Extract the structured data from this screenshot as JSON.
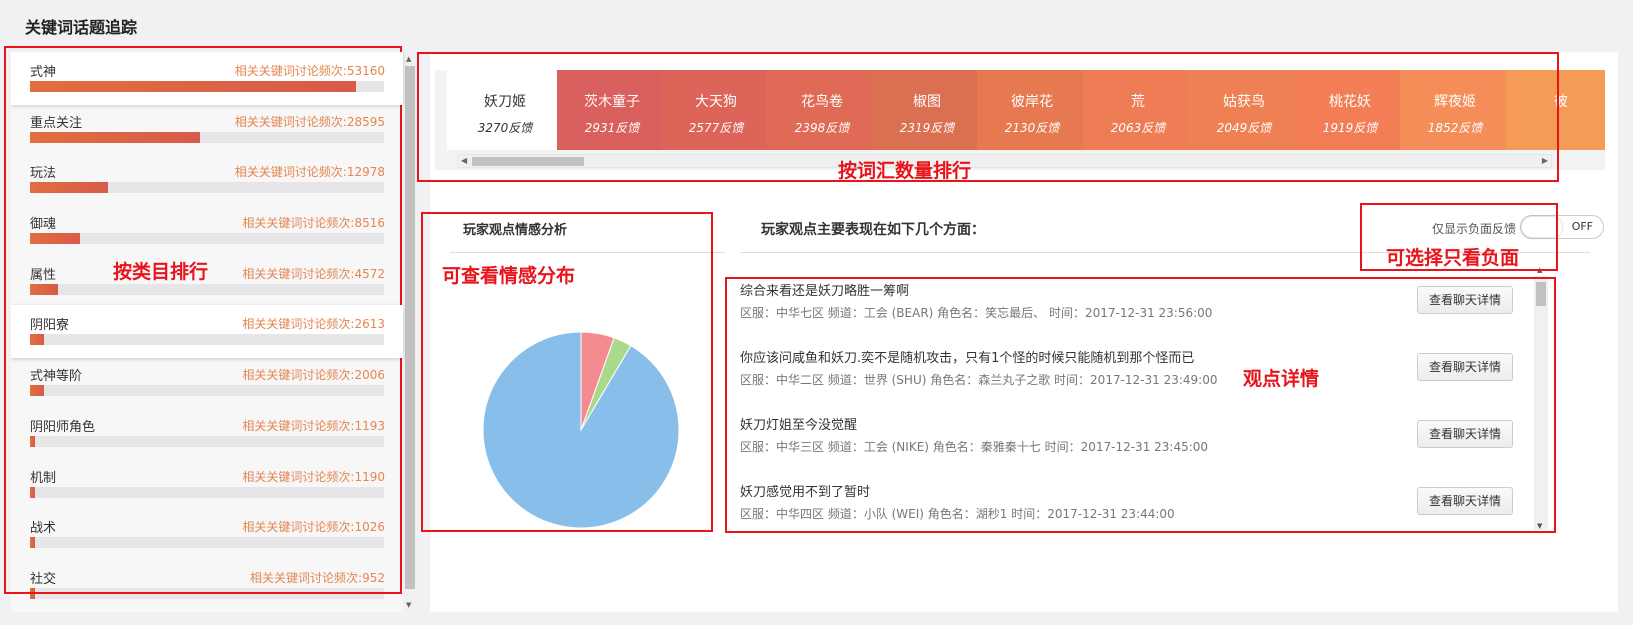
{
  "page": {
    "title": "关键词话题追踪"
  },
  "categories": [
    {
      "name": "式神",
      "count_text": "相关关键词讨论频次:53160",
      "fraction": 0.92
    },
    {
      "name": "重点关注",
      "count_text": "相关关键词讨论频次:28595",
      "fraction": 0.48
    },
    {
      "name": "玩法",
      "count_text": "相关关键词讨论频次:12978",
      "fraction": 0.22
    },
    {
      "name": "御魂",
      "count_text": "相关关键词讨论频次:8516",
      "fraction": 0.14
    },
    {
      "name": "属性",
      "count_text": "相关关键词讨论频次:4572",
      "fraction": 0.08
    },
    {
      "name": "阴阳寮",
      "count_text": "相关关键词讨论频次:2613",
      "fraction": 0.04
    },
    {
      "name": "式神等阶",
      "count_text": "相关关键词讨论频次:2006",
      "fraction": 0.04
    },
    {
      "name": "阴阳师角色",
      "count_text": "相关关键词讨论频次:1193",
      "fraction": 0.015
    },
    {
      "name": "机制",
      "count_text": "相关关键词讨论频次:1190",
      "fraction": 0.015
    },
    {
      "name": "战术",
      "count_text": "相关关键词讨论频次:1026",
      "fraction": 0.015
    },
    {
      "name": "社交",
      "count_text": "相关关键词讨论频次:952",
      "fraction": 0.015
    }
  ],
  "keyword_tabs": [
    {
      "name": "妖刀姬",
      "count": "3270反馈",
      "color": "#ffffff"
    },
    {
      "name": "茨木童子",
      "count": "2931反馈",
      "color": "#d9605c"
    },
    {
      "name": "大天狗",
      "count": "2577反馈",
      "color": "#dc6459"
    },
    {
      "name": "花鸟卷",
      "count": "2398反馈",
      "color": "#df6a55"
    },
    {
      "name": "椒图",
      "count": "2319反馈",
      "color": "#db6f51"
    },
    {
      "name": "彼岸花",
      "count": "2130反馈",
      "color": "#e6794f"
    },
    {
      "name": "荒",
      "count": "2063反馈",
      "color": "#ee7c55"
    },
    {
      "name": "姑获鸟",
      "count": "2049反馈",
      "color": "#ef8053"
    },
    {
      "name": "桃花妖",
      "count": "1919反馈",
      "color": "#f37e56"
    },
    {
      "name": "辉夜姬",
      "count": "1852反馈",
      "color": "#f48d58"
    },
    {
      "name": "彼",
      "count": "",
      "color": "#f59b58"
    }
  ],
  "sentiment": {
    "title": "玩家观点情感分析",
    "chart_data": {
      "type": "pie",
      "slices": [
        {
          "label": "",
          "value": 5.5,
          "color": "#f28c91"
        },
        {
          "label": "",
          "value": 3.0,
          "color": "#a9d98a"
        },
        {
          "label": "",
          "value": 91.5,
          "color": "#87bfea"
        }
      ]
    }
  },
  "aspects": {
    "title": "玩家观点主要表现在如下几个方面：",
    "toggle_label": "仅显示负面反馈",
    "toggle_state": "OFF",
    "button_label": "查看聊天详情",
    "opinions": [
      {
        "text": "综合来看还是妖刀略胜一筹啊",
        "meta": "区服：中华七区   频道：工会 (BEAR)   角色名：笑忘最后、   时间：2017-12-31 23:56:00"
      },
      {
        "text": "你应该问咸鱼和妖刀.奕不是随机攻击，只有1个怪的时候只能随机到那个怪而已",
        "meta": "区服：中华二区   频道：世界 (SHU)   角色名：森兰丸子之歌   时间：2017-12-31 23:49:00"
      },
      {
        "text": "妖刀灯姐至今没觉醒",
        "meta": "区服：中华三区   频道：工会 (NIKE)   角色名：秦雅秦十七   时间：2017-12-31 23:45:00"
      },
      {
        "text": "妖刀感觉用不到了暂时",
        "meta": "区服：中华四区   频道：小队 (WEI)   角色名：湖秒1   时间：2017-12-31 23:44:00"
      }
    ]
  },
  "annotations": {
    "by_category": "按类目排行",
    "by_volume": "按词汇数量排行",
    "sentiment_view": "可查看情感分布",
    "negative_only": "可选择只看负面",
    "opinion_detail": "观点详情"
  }
}
